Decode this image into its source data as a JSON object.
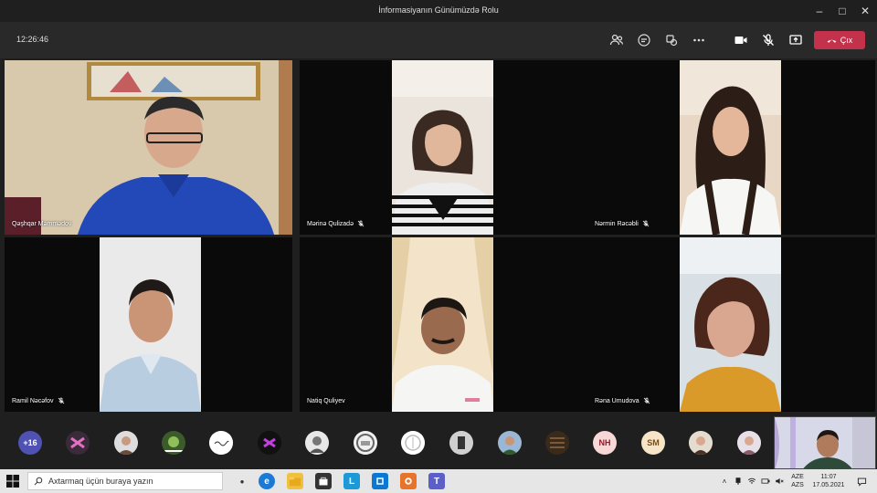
{
  "window": {
    "title": "İnformasiyanın Günümüzdə Rolu"
  },
  "toolbar": {
    "timer": "12:26:46",
    "leave_label": "Çıx"
  },
  "participants": [
    {
      "name": "Qəşhqar Məmmədov",
      "muted": false
    },
    {
      "name": "Mərinə Qulizadə",
      "muted": true
    },
    {
      "name": "Nərmin Rəcəbli",
      "muted": true
    },
    {
      "name": "Ramil Nəcəfov",
      "muted": true
    },
    {
      "name": "Natiq Quliyev",
      "muted": false
    },
    {
      "name": "Rəna Umudova",
      "muted": true
    }
  ],
  "strip": {
    "overflow_count": "+16",
    "initials": [
      "NH",
      "SM"
    ]
  },
  "taskbar": {
    "search_placeholder": "Axtarmaq üçün buraya yazın",
    "lang_top": "AZE",
    "lang_bottom": "AZS",
    "time": "11:07",
    "date": "17.05.2021"
  },
  "colors": {
    "leave": "#c4314b",
    "overflow_avatar": "#4f52b2"
  }
}
